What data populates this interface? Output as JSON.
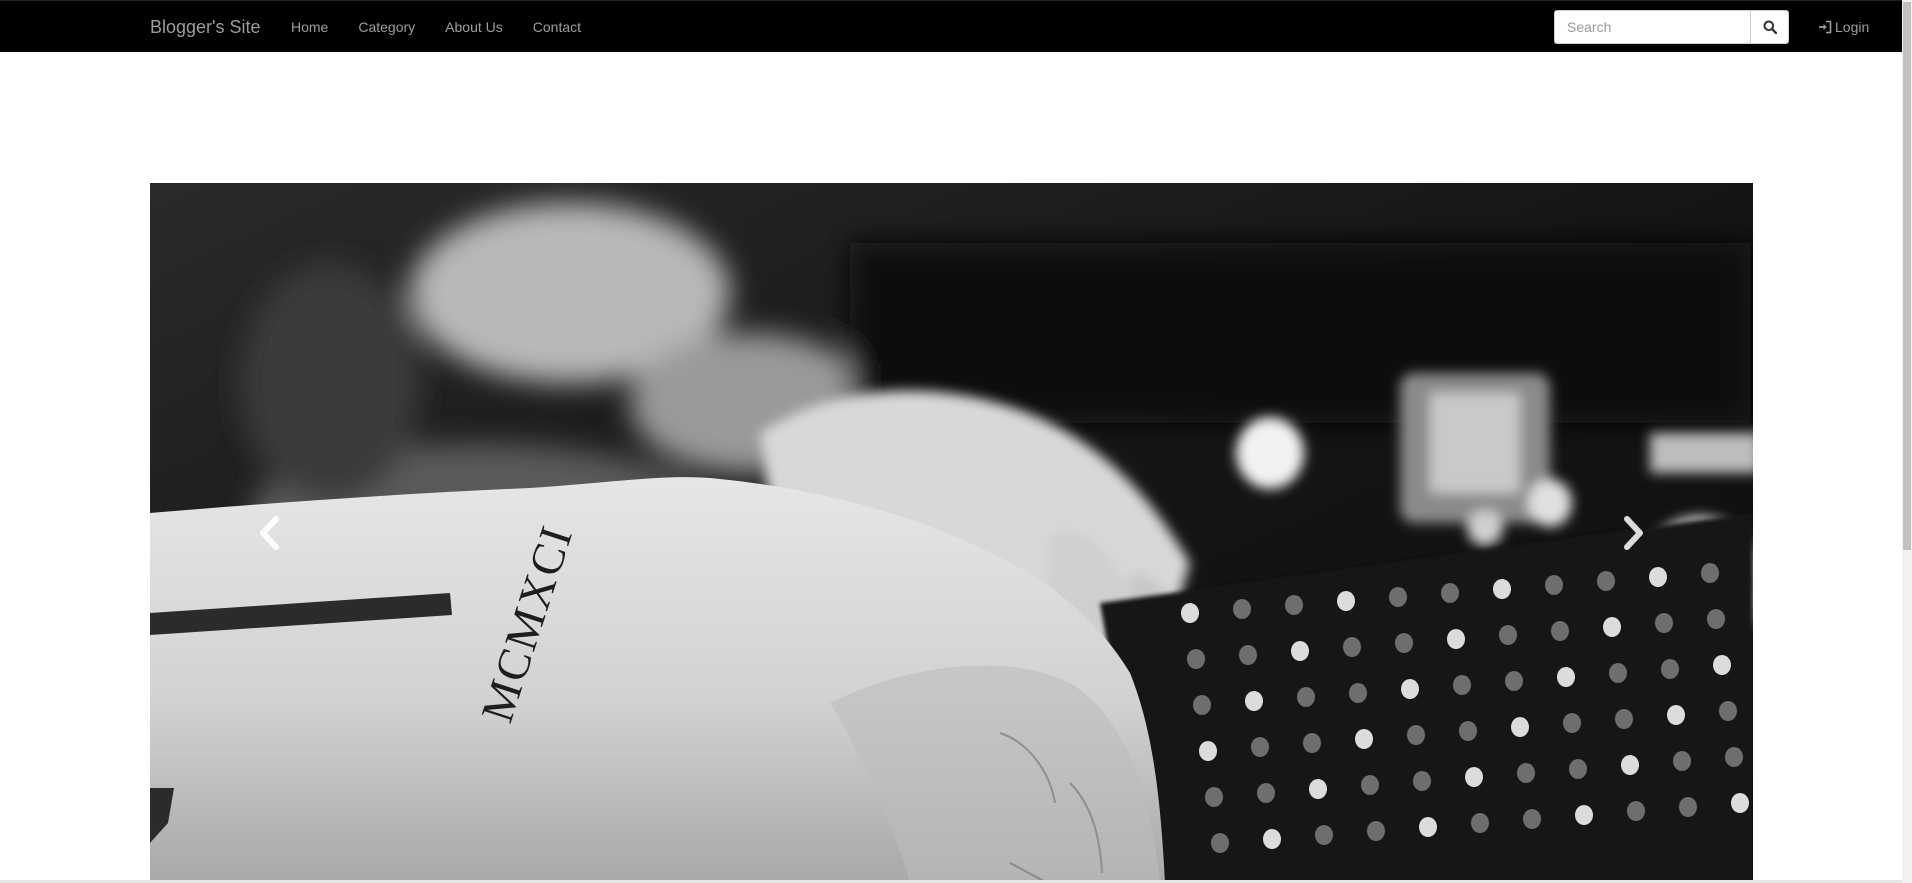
{
  "navbar": {
    "brand": "Blogger's Site",
    "links": [
      "Home",
      "Category",
      "About Us",
      "Contact"
    ],
    "search_placeholder": "Search",
    "login_label": "Login"
  },
  "carousel": {
    "tattoo_text": "MCMXCI",
    "prev_icon": "chevron-left-icon",
    "next_icon": "chevron-right-icon"
  },
  "colors": {
    "navbar_bg": "#000000",
    "nav_text": "#9d9d9d"
  }
}
